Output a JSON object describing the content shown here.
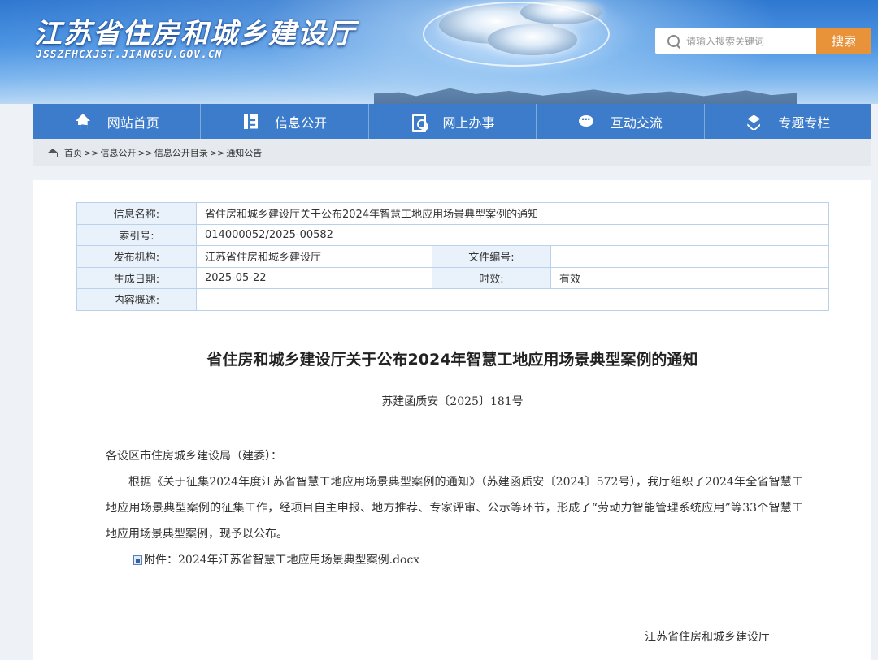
{
  "header": {
    "site_title": "江苏省住房和城乡建设厅",
    "site_domain": "JSSZFHCXJST.JIANGSU.GOV.CN",
    "search_placeholder": "请输入搜索关键词",
    "search_button": "搜索"
  },
  "nav": {
    "items": [
      {
        "label": "网站首页",
        "icon": "home-icon"
      },
      {
        "label": "信息公开",
        "icon": "info-list-icon"
      },
      {
        "label": "网上办事",
        "icon": "online-service-icon"
      },
      {
        "label": "互动交流",
        "icon": "chat-icon"
      },
      {
        "label": "专题专栏",
        "icon": "layers-icon"
      }
    ]
  },
  "breadcrumb": {
    "items": [
      "首页",
      "信息公开",
      "信息公开目录",
      "通知公告"
    ],
    "separator": ">>"
  },
  "meta": {
    "name_label": "信息名称:",
    "name_value": "省住房和城乡建设厅关于公布2024年智慧工地应用场景典型案例的通知",
    "index_label": "索引号:",
    "index_value": "014000052/2025-00582",
    "publisher_label": "发布机构:",
    "publisher_value": "江苏省住房和城乡建设厅",
    "doc_no_label": "文件编号:",
    "doc_no_value": "",
    "date_label": "生成日期:",
    "date_value": "2025-05-22",
    "validity_label": "时效:",
    "validity_value": "有效",
    "summary_label": "内容概述:",
    "summary_value": ""
  },
  "document": {
    "title": "省住房和城乡建设厅关于公布2024年智慧工地应用场景典型案例的通知",
    "number": "苏建函质安〔2025〕181号",
    "salutation": "各设区市住房城乡建设局（建委）：",
    "paragraph": "根据《关于征集2024年度江苏省智慧工地应用场景典型案例的通知》（苏建函质安〔2024〕572号），我厅组织了2024年全省智慧工地应用场景典型案例的征集工作，经项目自主申报、地方推荐、专家评审、公示等环节，形成了“劳动力智能管理系统应用”等33个智慧工地应用场景典型案例，现予以公布。",
    "attachment_prefix": "附件：",
    "attachment_name": "2024年江苏省智慧工地应用场景典型案例.docx",
    "issuer": "江苏省住房和城乡建设厅"
  },
  "colors": {
    "nav_bg": "#3d7ccb",
    "search_button_bg": "#e8923a",
    "table_border": "#b9d1ea",
    "table_label_bg": "#e9f1fa"
  }
}
